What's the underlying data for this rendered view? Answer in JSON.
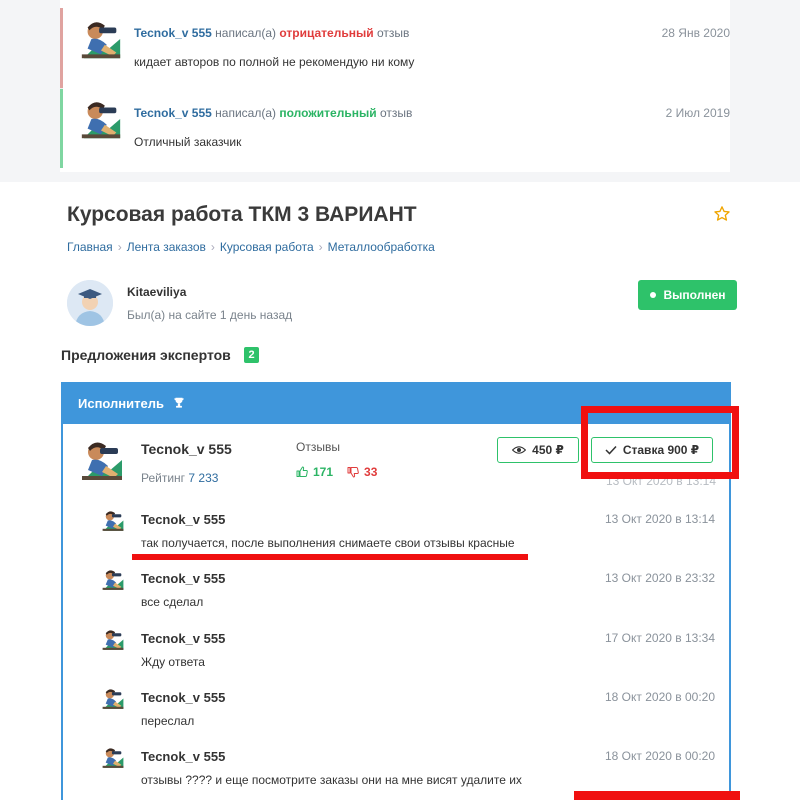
{
  "reviews": [
    {
      "user": "Tecnok_v 555",
      "wrote": "написал(а)",
      "kind": "отрицательный",
      "suffix": "отзыв",
      "date": "28 Янв 2020",
      "text": "кидает авторов по полной не рекомендую ни кому"
    },
    {
      "user": "Tecnok_v 555",
      "wrote": "написал(а)",
      "kind": "положительный",
      "suffix": "отзыв",
      "date": "2 Июл 2019",
      "text": "Отличный заказчик"
    }
  ],
  "order": {
    "title": "Курсовая работа ТКМ 3 ВАРИАНТ",
    "breadcrumbs": [
      "Главная",
      "Лента заказов",
      "Курсовая работа",
      "Металлообработка"
    ],
    "customer": {
      "name": "Kitaeviliya",
      "last_seen": "Был(а) на сайте 1 день назад"
    },
    "status": "Выполнен"
  },
  "offers": {
    "heading": "Предложения экспертов",
    "count": "2",
    "executor_label": "Исполнитель",
    "executor": {
      "name": "Tecnok_v 555",
      "rating_label": "Рейтинг",
      "rating_value": "7 233",
      "reviews_label": "Отзывы",
      "likes": "171",
      "dislikes": "33",
      "view_price": "450 ₽",
      "bid_label": "Ставка 900 ₽",
      "hidden_date": "13 Окт 2020 в 13:14"
    },
    "messages": [
      {
        "name": "Tecnok_v 555",
        "date": "13 Окт 2020 в 13:14",
        "text": "так получается, после выполнения снимаете свои отзывы красные"
      },
      {
        "name": "Tecnok_v 555",
        "date": "13 Окт 2020 в 23:32",
        "text": "все сделал"
      },
      {
        "name": "Tecnok_v 555",
        "date": "17 Окт 2020 в 13:34",
        "text": "Жду ответа"
      },
      {
        "name": "Tecnok_v 555",
        "date": "18 Окт 2020 в 00:20",
        "text": "переслал"
      },
      {
        "name": "Tecnok_v 555",
        "date": "18 Окт 2020 в 00:20",
        "text": "отзывы ???? и еще посмотрите заказы они на мне висят удалите их"
      }
    ]
  },
  "colors": {
    "accent_blue": "#3f96db",
    "success_green": "#2ec26a",
    "negative_red": "#e03c3c",
    "annotation_red": "#f01010"
  }
}
